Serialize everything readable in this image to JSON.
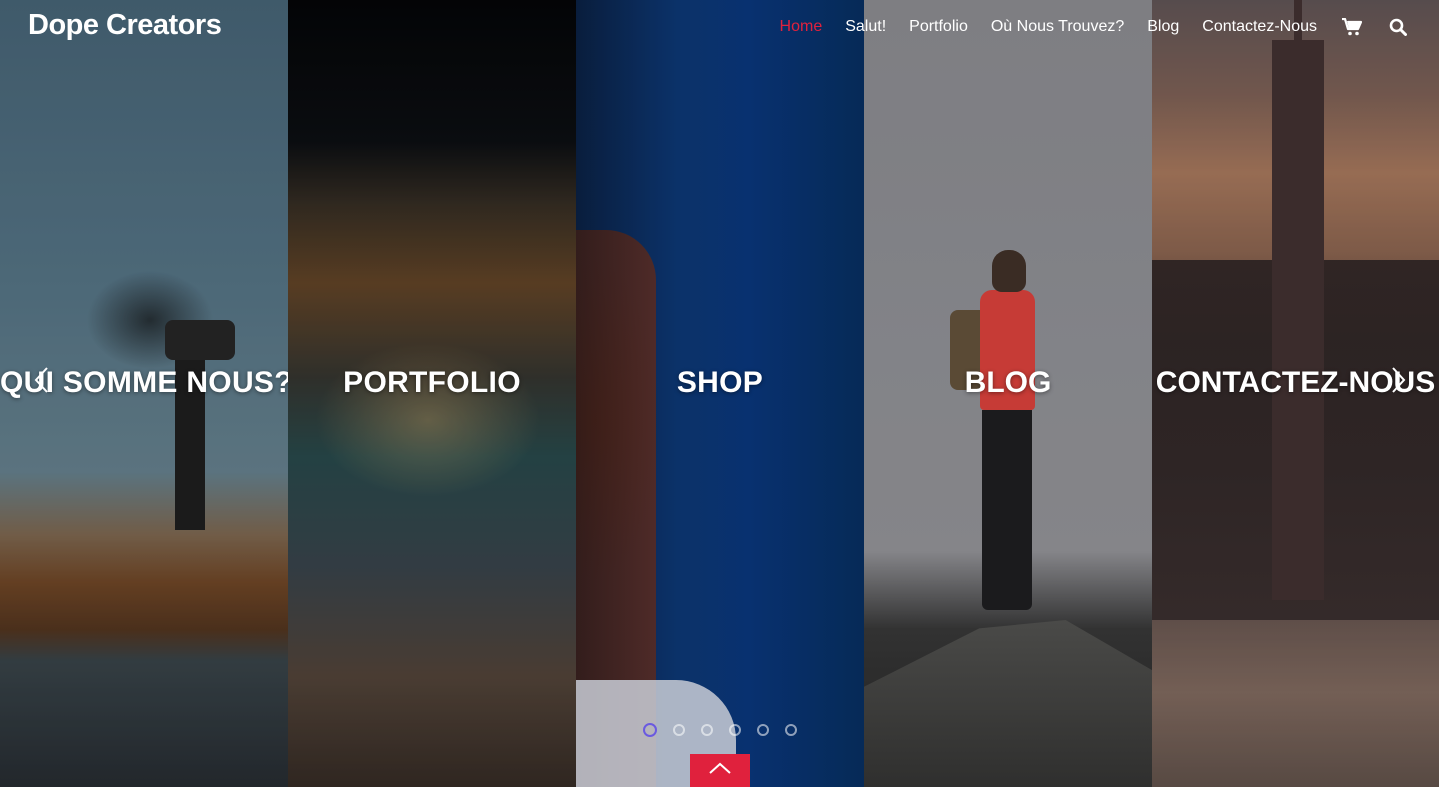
{
  "header": {
    "logo": "Dope Creators",
    "nav": [
      {
        "label": "Home",
        "active": true
      },
      {
        "label": "Salut!",
        "active": false
      },
      {
        "label": "Portfolio",
        "active": false
      },
      {
        "label": "Où Nous Trouvez?",
        "active": false
      },
      {
        "label": "Blog",
        "active": false
      },
      {
        "label": "Contactez-Nous",
        "active": false
      }
    ],
    "icons": [
      "cart-icon",
      "search-icon"
    ]
  },
  "panels": [
    {
      "title": "QUI SOMME NOUS?"
    },
    {
      "title": "PORTFOLIO"
    },
    {
      "title": "SHOP"
    },
    {
      "title": "BLOG"
    },
    {
      "title": "CONTACTEZ-NOUS"
    }
  ],
  "slider": {
    "dot_count": 6,
    "active_index": 0
  },
  "colors": {
    "accent": "#e0213d",
    "active_dot": "#6a5ae0",
    "text": "#ffffff"
  }
}
